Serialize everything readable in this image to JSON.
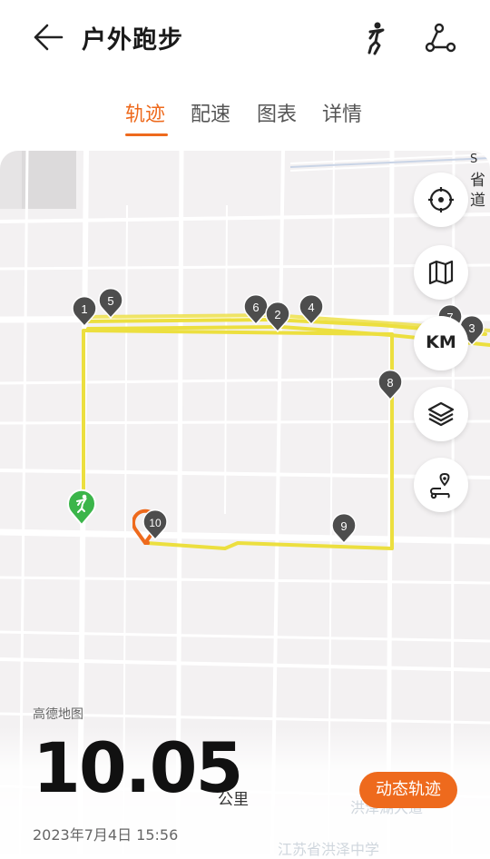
{
  "header": {
    "title": "户外跑步",
    "back_icon": "back-arrow-icon",
    "runner_icon": "runner-icon",
    "share_route_icon": "route-share-icon"
  },
  "tabs": [
    {
      "label": "轨迹",
      "active": true
    },
    {
      "label": "配速",
      "active": false
    },
    {
      "label": "图表",
      "active": false
    },
    {
      "label": "详情",
      "active": false
    }
  ],
  "map": {
    "road_label": [
      "省",
      "道"
    ],
    "road_label_prefix": "S",
    "attribution": "高德地图",
    "km_button": "KM",
    "controls": [
      "locate-icon",
      "map-mode-icon",
      "km-marker-toggle",
      "layers-icon",
      "route-replay-icon"
    ],
    "km_markers": [
      "1",
      "2",
      "3",
      "4",
      "5",
      "6",
      "7",
      "8",
      "9",
      "10"
    ],
    "faint_labels": [
      "洪泽湖大道",
      "江苏省洪泽中学"
    ]
  },
  "summary": {
    "distance": "10.05",
    "unit": "公里",
    "date": "2023年7月4日 15:56",
    "dynamic_track_button": "动态轨迹"
  },
  "colors": {
    "accent": "#ee6a1d",
    "track": "#ecdf3f",
    "start_marker": "#3bb54a",
    "end_marker": "#ee6a1d",
    "km_marker": "#4d4d4d"
  }
}
